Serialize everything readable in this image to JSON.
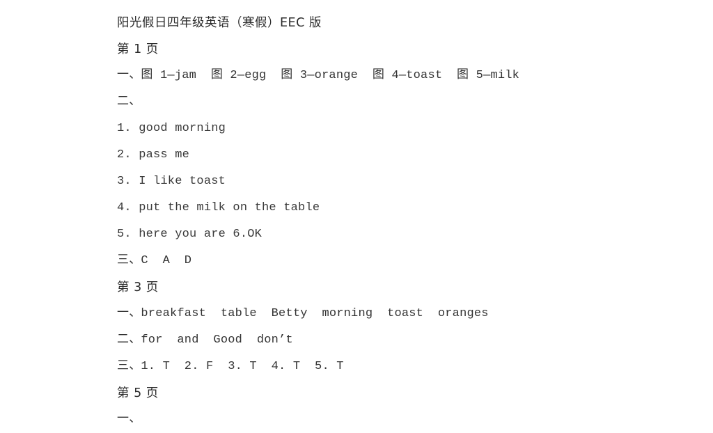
{
  "document": {
    "title": "阳光假日四年级英语（寒假）EEC 版",
    "text_color": "#333333",
    "background_color": "#ffffff",
    "lines": [
      {
        "id": "title",
        "kind": "title",
        "text": "阳光假日四年级英语（寒假）EEC 版"
      },
      {
        "id": "page-1",
        "kind": "page-marker",
        "text": "第 1 页"
      },
      {
        "id": "p1-sec-1",
        "kind": "section",
        "text": "一、图 1—jam  图 2—egg  图 3—orange  图 4—toast  图 5—milk"
      },
      {
        "id": "p1-sec-2",
        "kind": "section",
        "text": "二、"
      },
      {
        "id": "p1-q1",
        "kind": "numbered",
        "text": "1. good morning"
      },
      {
        "id": "p1-q2",
        "kind": "numbered",
        "text": "2. pass me"
      },
      {
        "id": "p1-q3",
        "kind": "numbered",
        "text": "3. I like toast"
      },
      {
        "id": "p1-q4",
        "kind": "numbered",
        "text": "4. put the milk on the table"
      },
      {
        "id": "p1-q5",
        "kind": "numbered",
        "text": "5. here you are 6.OK"
      },
      {
        "id": "p1-sec-3",
        "kind": "section",
        "text": "三、C  A  D"
      },
      {
        "id": "page-3",
        "kind": "page-marker",
        "text": "第 3 页"
      },
      {
        "id": "p3-sec-1",
        "kind": "section",
        "text": "一、breakfast  table  Betty  morning  toast  oranges"
      },
      {
        "id": "p3-sec-2",
        "kind": "section",
        "text": "二、for  and  Good  don’t"
      },
      {
        "id": "p3-sec-3",
        "kind": "section",
        "text": "三、1. T  2. F  3. T  4. T  5. T"
      },
      {
        "id": "page-5",
        "kind": "page-marker",
        "text": "第 5 页"
      },
      {
        "id": "p5-sec-1",
        "kind": "section",
        "text": "一、"
      }
    ]
  }
}
